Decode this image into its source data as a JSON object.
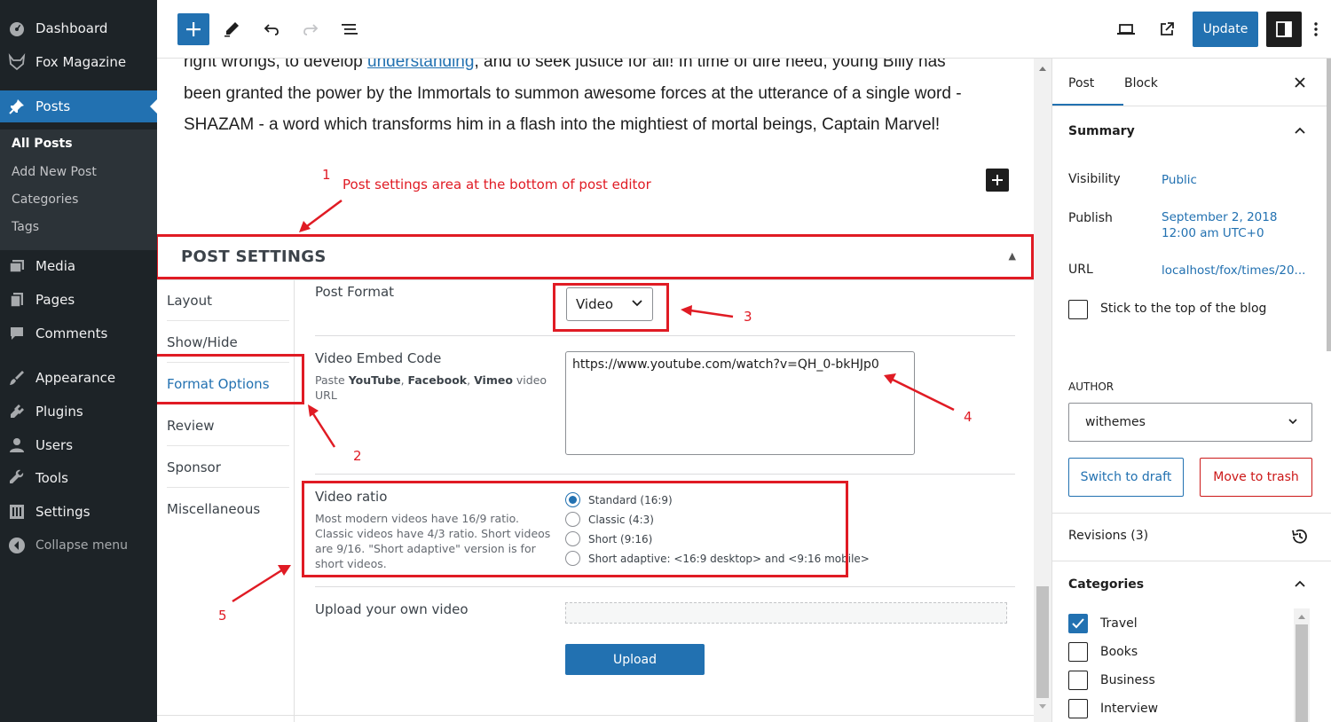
{
  "admin_menu": {
    "dashboard": "Dashboard",
    "site_name": "Fox Magazine",
    "posts": "Posts",
    "posts_sub": [
      "All Posts",
      "Add New Post",
      "Categories",
      "Tags"
    ],
    "media": "Media",
    "pages": "Pages",
    "comments": "Comments",
    "appearance": "Appearance",
    "plugins": "Plugins",
    "users": "Users",
    "tools": "Tools",
    "settings": "Settings",
    "collapse": "Collapse menu"
  },
  "toolbar": {
    "update_label": "Update"
  },
  "content": {
    "line1_before": "right wrongs, to develop ",
    "line1_link": "understanding",
    "line1_after": ", and to seek justice for all! In time of dire need, young Billy has",
    "line2": "been granted the power by the Immortals to summon awesome forces at the utterance of a single word -",
    "line3": "SHAZAM - a word which transforms him in a flash into the mightiest of mortal beings, Captain Marvel!"
  },
  "annotations": {
    "n1": "1",
    "label1": "Post settings area at the bottom of post editor",
    "n2": "2",
    "n3": "3",
    "n4": "4",
    "n5": "5"
  },
  "post_settings": {
    "title": "POST SETTINGS",
    "tabs": [
      "Layout",
      "Show/Hide",
      "Format Options",
      "Review",
      "Sponsor",
      "Miscellaneous"
    ],
    "post_format_label": "Post Format",
    "post_format_value": "Video",
    "embed_label": "Video Embed Code",
    "embed_desc_pre": "Paste ",
    "embed_desc_b1": "YouTube",
    "embed_desc_sep1": ", ",
    "embed_desc_b2": "Facebook",
    "embed_desc_sep2": ", ",
    "embed_desc_b3": "Vimeo",
    "embed_desc_post": " video",
    "embed_desc_line2": "URL",
    "embed_value": "https://www.youtube.com/watch?v=QH_0-bkHJp0",
    "ratio_label": "Video ratio",
    "ratio_desc": [
      "Most modern videos have 16/9 ratio.",
      "Classic videos have 4/3 ratio. Short videos",
      "are 9/16. \"Short adaptive\" version is for",
      "short videos."
    ],
    "ratio_options": [
      "Standard (16:9)",
      "Classic (4:3)",
      "Short (9:16)",
      "Short adaptive: <16:9 desktop> and <9:16 mobile>"
    ],
    "ratio_selected": "Standard (16:9)",
    "upload_label": "Upload your own video",
    "upload_button": "Upload"
  },
  "sidebar": {
    "tab_post": "Post",
    "tab_block": "Block",
    "summary": "Summary",
    "visibility_label": "Visibility",
    "visibility_value": "Public",
    "publish_label": "Publish",
    "publish_date": "September 2, 2018",
    "publish_time": "12:00 am UTC+0",
    "url_label": "URL",
    "url_value": "localhost/fox/times/20...",
    "sticky_label": "Stick to the top of the blog",
    "author_heading": "AUTHOR",
    "author_value": "withemes",
    "switch_draft": "Switch to draft",
    "move_trash": "Move to trash",
    "revisions": "Revisions (3)",
    "categories_heading": "Categories",
    "categories": [
      {
        "name": "Travel",
        "checked": true
      },
      {
        "name": "Books",
        "checked": false
      },
      {
        "name": "Business",
        "checked": false
      },
      {
        "name": "Interview",
        "checked": false
      }
    ]
  },
  "colors": {
    "admin_bg": "#1d2327",
    "accent": "#2271b1",
    "annotation_red": "#e01b24",
    "danger": "#cc1818"
  }
}
